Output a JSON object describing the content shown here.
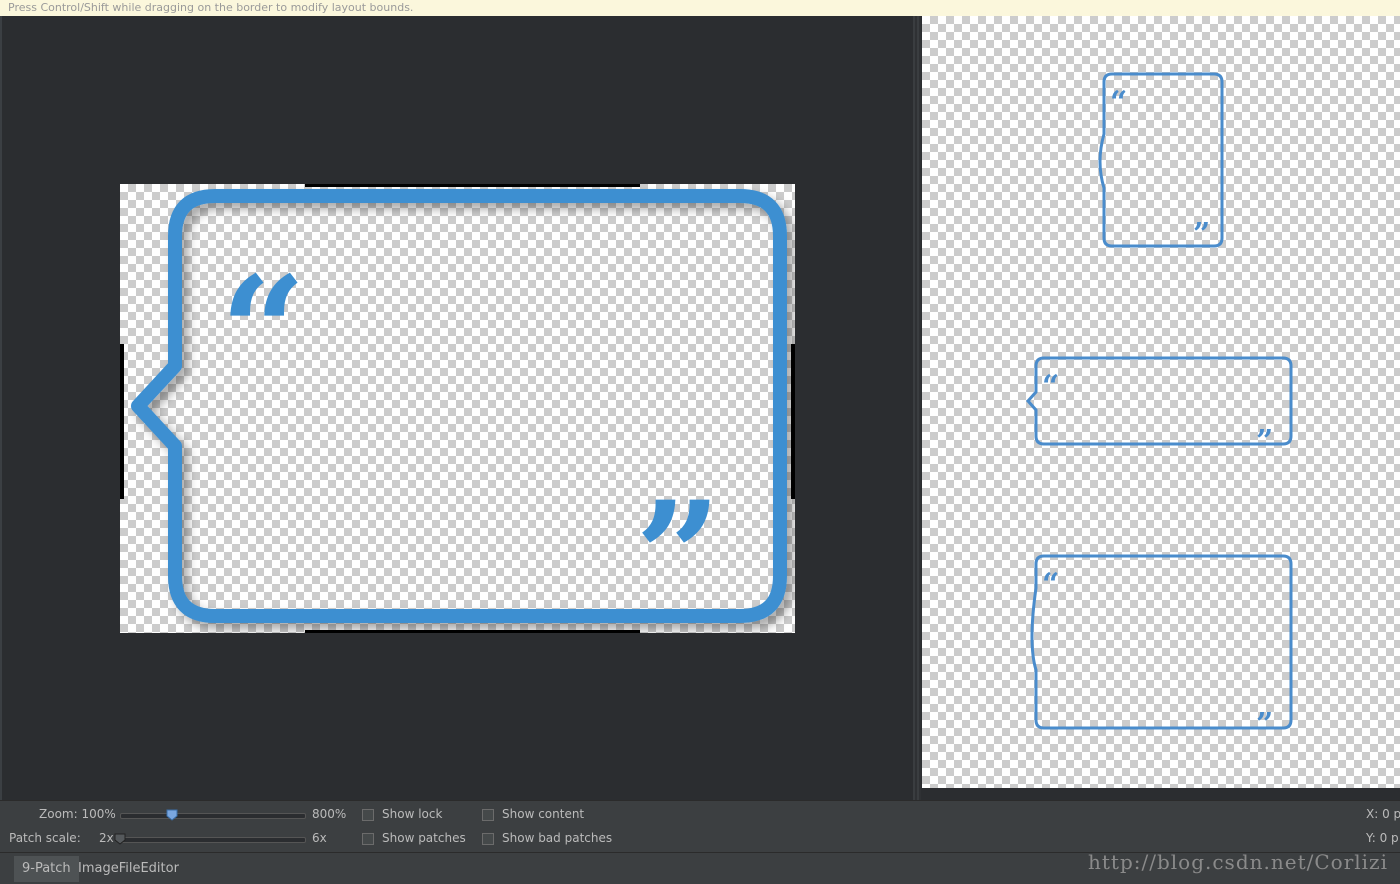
{
  "hint_bar": {
    "text": "Press Control/Shift while dragging on the border to modify layout bounds."
  },
  "controls": {
    "zoom_label": "Zoom: 100%",
    "zoom_max": "800%",
    "zoom_level": 0.27,
    "patch_scale_label": "Patch scale:",
    "patch_scale_min": "2x",
    "patch_scale_max": "6x",
    "patch_scale_level": 0.0,
    "show_lock": "Show lock",
    "show_content": "Show content",
    "show_patches": "Show patches",
    "show_bad_patches": "Show bad patches",
    "x_readout": "X: 0 p",
    "y_readout": "Y: 0 p"
  },
  "tabs": [
    {
      "label": "9-Patch",
      "active": true
    },
    {
      "label": "ImageFileEditor",
      "active": false
    }
  ],
  "watermark": "http://blog.csdn.net/Corlizi",
  "colors": {
    "bubble_stroke": "#3d8fd1",
    "bubble_preview_stroke": "#4a8ccc",
    "editor_bg": "#2b2d30",
    "panel_bg": "#3c3f41",
    "hint_bg": "#fbf7dc"
  },
  "icons": {
    "open_quote": "“",
    "close_quote": "”"
  }
}
